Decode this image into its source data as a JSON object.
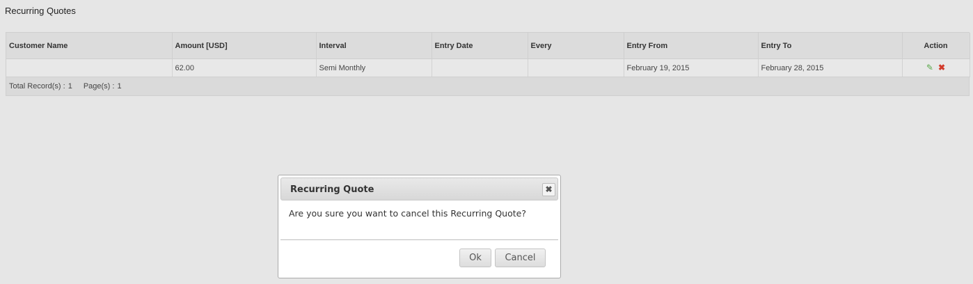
{
  "page": {
    "title": "Recurring Quotes"
  },
  "table": {
    "columns": [
      "Customer Name",
      "Amount [USD]",
      "Interval",
      "Entry Date",
      "Every",
      "Entry From",
      "Entry To",
      "Action"
    ],
    "rows": [
      {
        "customer_name": "",
        "amount": "62.00",
        "interval": "Semi Monthly",
        "entry_date": "",
        "every": "",
        "entry_from": "February 19, 2015",
        "entry_to": "February 28, 2015",
        "actions": [
          {
            "icon": "edit-icon",
            "glyph": "✎",
            "color": "#5aa84a"
          },
          {
            "icon": "delete-icon",
            "glyph": "✖",
            "color": "#d23a2a"
          }
        ]
      }
    ],
    "footer": {
      "total_label": "Total Record(s) :",
      "total_value": "1",
      "pages_label": "Page(s) :",
      "pages_value": "1"
    }
  },
  "dialog": {
    "title": "Recurring Quote",
    "close_glyph": "✖",
    "message": "Are you sure you want to cancel this Recurring Quote?",
    "ok_label": "Ok",
    "cancel_label": "Cancel"
  },
  "colors": {
    "background": "#e6e6e6",
    "edit_icon": "#5aa84a",
    "delete_icon": "#d23a2a"
  }
}
